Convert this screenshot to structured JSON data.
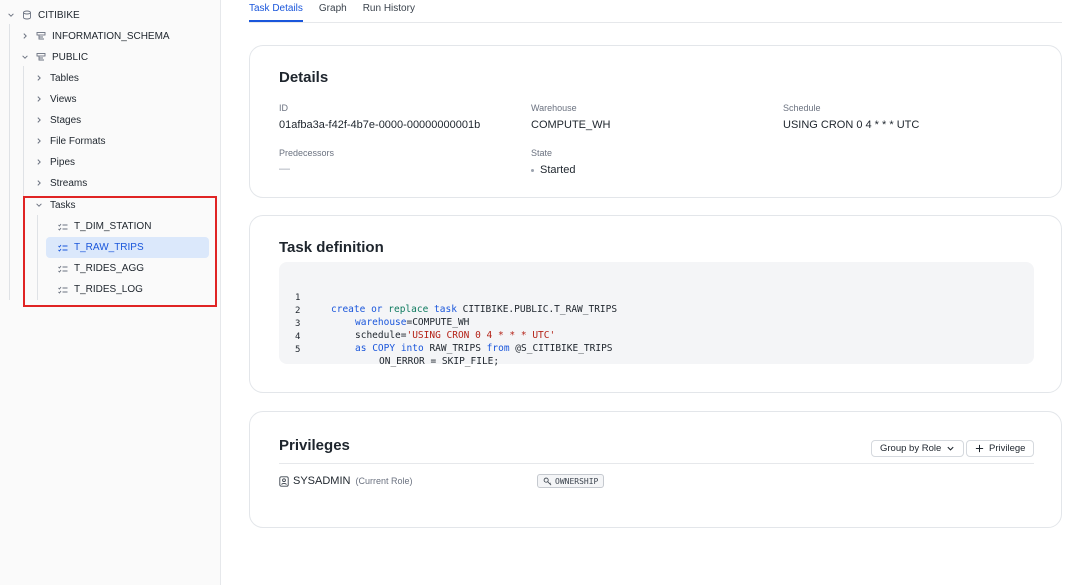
{
  "sidebar": {
    "database": "CITIBIKE",
    "schemas": [
      "INFORMATION_SCHEMA",
      "PUBLIC"
    ],
    "folders": [
      "Tables",
      "Views",
      "Stages",
      "File Formats",
      "Pipes",
      "Streams",
      "Tasks"
    ],
    "tasks": [
      "T_DIM_STATION",
      "T_RAW_TRIPS",
      "T_RIDES_AGG",
      "T_RIDES_LOG"
    ],
    "selected_task": "T_RAW_TRIPS"
  },
  "tabs": [
    {
      "label": "Task Details",
      "active": true
    },
    {
      "label": "Graph",
      "active": false
    },
    {
      "label": "Run History",
      "active": false
    }
  ],
  "details": {
    "title": "Details",
    "id_label": "ID",
    "id_value": "01afba3a-f42f-4b7e-0000-00000000001b",
    "warehouse_label": "Warehouse",
    "warehouse_value": "COMPUTE_WH",
    "schedule_label": "Schedule",
    "schedule_value": "USING CRON 0 4 * * * UTC",
    "predecessors_label": "Predecessors",
    "predecessors_value": "—",
    "state_label": "State",
    "state_value": "Started"
  },
  "definition": {
    "title": "Task definition",
    "line_numbers": [
      "1",
      "2",
      "3",
      "4",
      "5"
    ],
    "l1_create": "create",
    "l1_or": "or",
    "l1_replace": "replace",
    "l1_task": "task",
    "l1_name": "CITIBIKE.PUBLIC.T_RAW_TRIPS",
    "l2_kw": "warehouse",
    "l2_rest": "=COMPUTE_WH",
    "l3_kw": "schedule=",
    "l3_str": "'USING CRON 0 4 * * * UTC'",
    "l4_as": "as",
    "l4_copy": "COPY",
    "l4_into": "into",
    "l4_table": "RAW_TRIPS",
    "l4_from": "from",
    "l4_stage": "@S_CITIBIKE_TRIPS",
    "l5": "ON_ERROR = SKIP_FILE;"
  },
  "privileges": {
    "title": "Privileges",
    "group_button": "Group by Role",
    "add_button": "Privilege",
    "role": "SYSADMIN",
    "role_note": "(Current Role)",
    "privilege_badge": "OWNERSHIP"
  },
  "colors": {
    "accent": "#1a56db",
    "selected_bg": "#dbe8fb",
    "highlight": "#e02424"
  }
}
